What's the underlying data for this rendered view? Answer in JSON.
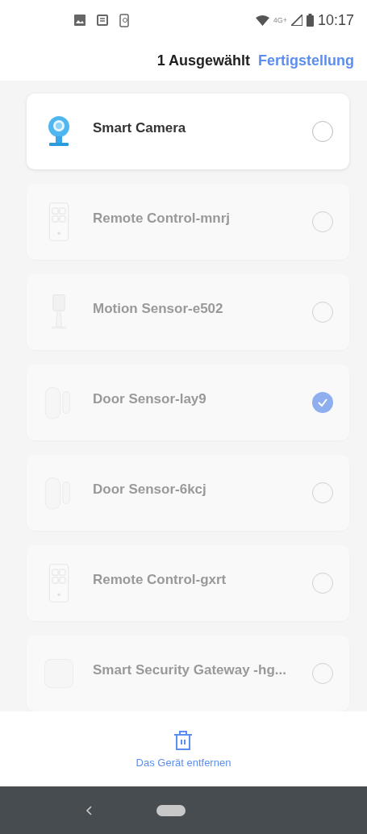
{
  "status_bar": {
    "time": "10:17",
    "network": "4G+"
  },
  "header": {
    "selection_count": "1 Ausgewählt",
    "done_button": "Fertigstellung"
  },
  "devices": [
    {
      "name": "Smart Camera",
      "kind": "camera",
      "disabled": false,
      "selected": false
    },
    {
      "name": "Remote Control-mnrj",
      "kind": "remote",
      "disabled": true,
      "selected": false
    },
    {
      "name": "Motion Sensor-e502",
      "kind": "motion",
      "disabled": true,
      "selected": false
    },
    {
      "name": "Door Sensor-lay9",
      "kind": "door",
      "disabled": true,
      "selected": true
    },
    {
      "name": "Door Sensor-6kcj",
      "kind": "door",
      "disabled": true,
      "selected": false
    },
    {
      "name": "Remote Control-gxrt",
      "kind": "remote",
      "disabled": true,
      "selected": false
    },
    {
      "name": "Smart Security Gateway -hg...",
      "kind": "gateway",
      "disabled": true,
      "selected": false
    }
  ],
  "remove_button": "Das Gerät entfernen"
}
